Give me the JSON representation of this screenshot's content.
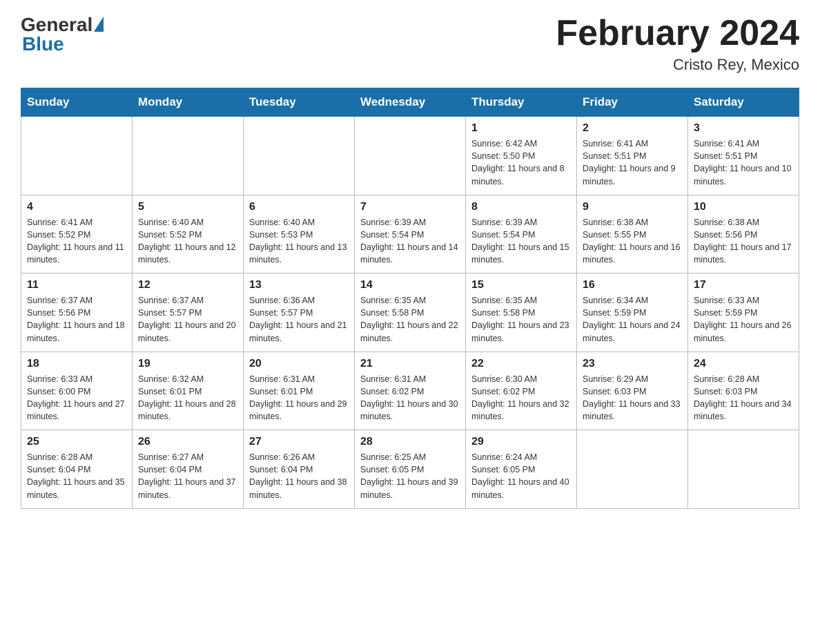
{
  "header": {
    "logo": {
      "general": "General",
      "blue": "Blue"
    },
    "title": "February 2024",
    "location": "Cristo Rey, Mexico"
  },
  "weekdays": [
    "Sunday",
    "Monday",
    "Tuesday",
    "Wednesday",
    "Thursday",
    "Friday",
    "Saturday"
  ],
  "weeks": [
    [
      {
        "day": "",
        "info": ""
      },
      {
        "day": "",
        "info": ""
      },
      {
        "day": "",
        "info": ""
      },
      {
        "day": "",
        "info": ""
      },
      {
        "day": "1",
        "info": "Sunrise: 6:42 AM\nSunset: 5:50 PM\nDaylight: 11 hours and 8 minutes."
      },
      {
        "day": "2",
        "info": "Sunrise: 6:41 AM\nSunset: 5:51 PM\nDaylight: 11 hours and 9 minutes."
      },
      {
        "day": "3",
        "info": "Sunrise: 6:41 AM\nSunset: 5:51 PM\nDaylight: 11 hours and 10 minutes."
      }
    ],
    [
      {
        "day": "4",
        "info": "Sunrise: 6:41 AM\nSunset: 5:52 PM\nDaylight: 11 hours and 11 minutes."
      },
      {
        "day": "5",
        "info": "Sunrise: 6:40 AM\nSunset: 5:52 PM\nDaylight: 11 hours and 12 minutes."
      },
      {
        "day": "6",
        "info": "Sunrise: 6:40 AM\nSunset: 5:53 PM\nDaylight: 11 hours and 13 minutes."
      },
      {
        "day": "7",
        "info": "Sunrise: 6:39 AM\nSunset: 5:54 PM\nDaylight: 11 hours and 14 minutes."
      },
      {
        "day": "8",
        "info": "Sunrise: 6:39 AM\nSunset: 5:54 PM\nDaylight: 11 hours and 15 minutes."
      },
      {
        "day": "9",
        "info": "Sunrise: 6:38 AM\nSunset: 5:55 PM\nDaylight: 11 hours and 16 minutes."
      },
      {
        "day": "10",
        "info": "Sunrise: 6:38 AM\nSunset: 5:56 PM\nDaylight: 11 hours and 17 minutes."
      }
    ],
    [
      {
        "day": "11",
        "info": "Sunrise: 6:37 AM\nSunset: 5:56 PM\nDaylight: 11 hours and 18 minutes."
      },
      {
        "day": "12",
        "info": "Sunrise: 6:37 AM\nSunset: 5:57 PM\nDaylight: 11 hours and 20 minutes."
      },
      {
        "day": "13",
        "info": "Sunrise: 6:36 AM\nSunset: 5:57 PM\nDaylight: 11 hours and 21 minutes."
      },
      {
        "day": "14",
        "info": "Sunrise: 6:35 AM\nSunset: 5:58 PM\nDaylight: 11 hours and 22 minutes."
      },
      {
        "day": "15",
        "info": "Sunrise: 6:35 AM\nSunset: 5:58 PM\nDaylight: 11 hours and 23 minutes."
      },
      {
        "day": "16",
        "info": "Sunrise: 6:34 AM\nSunset: 5:59 PM\nDaylight: 11 hours and 24 minutes."
      },
      {
        "day": "17",
        "info": "Sunrise: 6:33 AM\nSunset: 5:59 PM\nDaylight: 11 hours and 26 minutes."
      }
    ],
    [
      {
        "day": "18",
        "info": "Sunrise: 6:33 AM\nSunset: 6:00 PM\nDaylight: 11 hours and 27 minutes."
      },
      {
        "day": "19",
        "info": "Sunrise: 6:32 AM\nSunset: 6:01 PM\nDaylight: 11 hours and 28 minutes."
      },
      {
        "day": "20",
        "info": "Sunrise: 6:31 AM\nSunset: 6:01 PM\nDaylight: 11 hours and 29 minutes."
      },
      {
        "day": "21",
        "info": "Sunrise: 6:31 AM\nSunset: 6:02 PM\nDaylight: 11 hours and 30 minutes."
      },
      {
        "day": "22",
        "info": "Sunrise: 6:30 AM\nSunset: 6:02 PM\nDaylight: 11 hours and 32 minutes."
      },
      {
        "day": "23",
        "info": "Sunrise: 6:29 AM\nSunset: 6:03 PM\nDaylight: 11 hours and 33 minutes."
      },
      {
        "day": "24",
        "info": "Sunrise: 6:28 AM\nSunset: 6:03 PM\nDaylight: 11 hours and 34 minutes."
      }
    ],
    [
      {
        "day": "25",
        "info": "Sunrise: 6:28 AM\nSunset: 6:04 PM\nDaylight: 11 hours and 35 minutes."
      },
      {
        "day": "26",
        "info": "Sunrise: 6:27 AM\nSunset: 6:04 PM\nDaylight: 11 hours and 37 minutes."
      },
      {
        "day": "27",
        "info": "Sunrise: 6:26 AM\nSunset: 6:04 PM\nDaylight: 11 hours and 38 minutes."
      },
      {
        "day": "28",
        "info": "Sunrise: 6:25 AM\nSunset: 6:05 PM\nDaylight: 11 hours and 39 minutes."
      },
      {
        "day": "29",
        "info": "Sunrise: 6:24 AM\nSunset: 6:05 PM\nDaylight: 11 hours and 40 minutes."
      },
      {
        "day": "",
        "info": ""
      },
      {
        "day": "",
        "info": ""
      }
    ]
  ]
}
